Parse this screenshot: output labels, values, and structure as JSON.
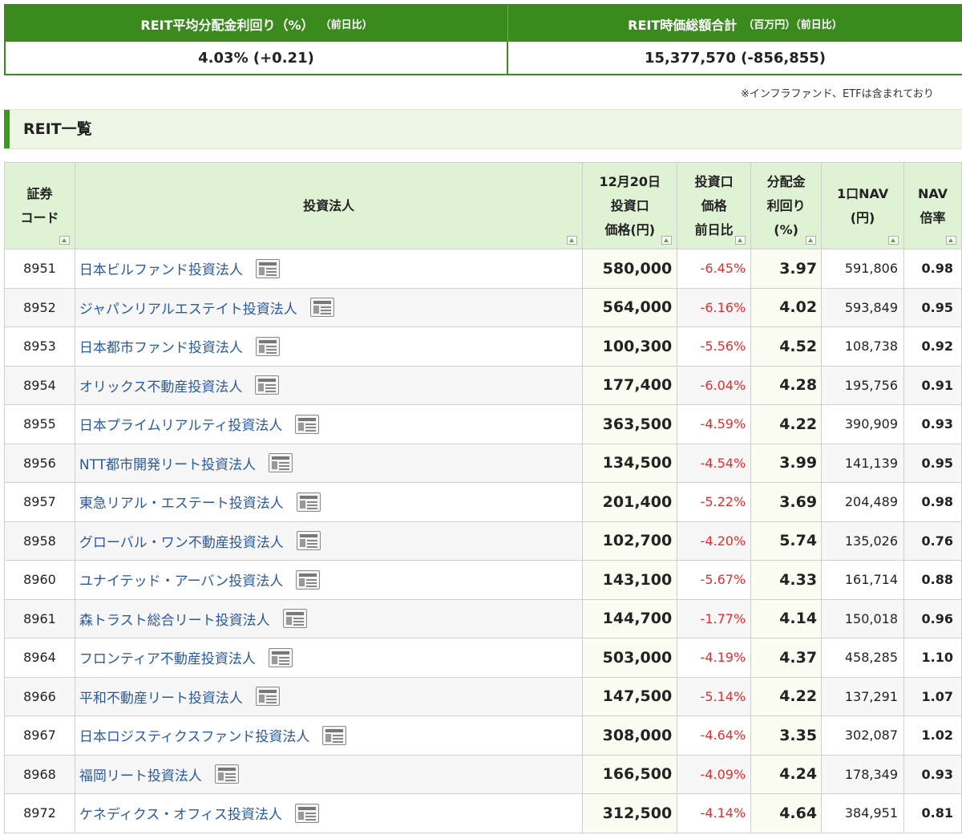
{
  "summary": {
    "yield_header": "REIT平均分配金利回り（%）",
    "yield_header_sub": "（前日比）",
    "yield_value": "4.03% (+0.21)",
    "mcap_header": "REIT時価総額合計",
    "mcap_header_sub": "（百万円）（前日比）",
    "mcap_value": "15,377,570 (-856,855)"
  },
  "note": "※インフラファンド、ETFは含まれており",
  "section_title": "REIT一覧",
  "table": {
    "headers": {
      "code": [
        "証券",
        "コード"
      ],
      "name": "投資法人",
      "price": [
        "12月20日",
        "投資口",
        "価格(円)"
      ],
      "change": [
        "投資口",
        "価格",
        "前日比"
      ],
      "yield": [
        "分配金",
        "利回り",
        "(%)"
      ],
      "nav": [
        "1口NAV",
        "(円)"
      ],
      "ratio": [
        "NAV",
        "倍率"
      ]
    },
    "rows": [
      {
        "code": "8951",
        "name": "日本ビルファンド投資法人",
        "price": "580,000",
        "change": "-6.45%",
        "yield": "3.97",
        "nav": "591,806",
        "ratio": "0.98"
      },
      {
        "code": "8952",
        "name": "ジャパンリアルエステイト投資法人",
        "price": "564,000",
        "change": "-6.16%",
        "yield": "4.02",
        "nav": "593,849",
        "ratio": "0.95"
      },
      {
        "code": "8953",
        "name": "日本都市ファンド投資法人",
        "price": "100,300",
        "change": "-5.56%",
        "yield": "4.52",
        "nav": "108,738",
        "ratio": "0.92"
      },
      {
        "code": "8954",
        "name": "オリックス不動産投資法人",
        "price": "177,400",
        "change": "-6.04%",
        "yield": "4.28",
        "nav": "195,756",
        "ratio": "0.91"
      },
      {
        "code": "8955",
        "name": "日本プライムリアルティ投資法人",
        "price": "363,500",
        "change": "-4.59%",
        "yield": "4.22",
        "nav": "390,909",
        "ratio": "0.93"
      },
      {
        "code": "8956",
        "name": "NTT都市開発リート投資法人",
        "price": "134,500",
        "change": "-4.54%",
        "yield": "3.99",
        "nav": "141,139",
        "ratio": "0.95"
      },
      {
        "code": "8957",
        "name": "東急リアル・エステート投資法人",
        "price": "201,400",
        "change": "-5.22%",
        "yield": "3.69",
        "nav": "204,489",
        "ratio": "0.98"
      },
      {
        "code": "8958",
        "name": "グローバル・ワン不動産投資法人",
        "price": "102,700",
        "change": "-4.20%",
        "yield": "5.74",
        "nav": "135,026",
        "ratio": "0.76"
      },
      {
        "code": "8960",
        "name": "ユナイテッド・アーバン投資法人",
        "price": "143,100",
        "change": "-5.67%",
        "yield": "4.33",
        "nav": "161,714",
        "ratio": "0.88"
      },
      {
        "code": "8961",
        "name": "森トラスト総合リート投資法人",
        "price": "144,700",
        "change": "-1.77%",
        "yield": "4.14",
        "nav": "150,018",
        "ratio": "0.96"
      },
      {
        "code": "8964",
        "name": "フロンティア不動産投資法人",
        "price": "503,000",
        "change": "-4.19%",
        "yield": "4.37",
        "nav": "458,285",
        "ratio": "1.10"
      },
      {
        "code": "8966",
        "name": "平和不動産リート投資法人",
        "price": "147,500",
        "change": "-5.14%",
        "yield": "4.22",
        "nav": "137,291",
        "ratio": "1.07"
      },
      {
        "code": "8967",
        "name": "日本ロジスティクスファンド投資法人",
        "price": "308,000",
        "change": "-4.64%",
        "yield": "3.35",
        "nav": "302,087",
        "ratio": "1.02"
      },
      {
        "code": "8968",
        "name": "福岡リート投資法人",
        "price": "166,500",
        "change": "-4.09%",
        "yield": "4.24",
        "nav": "178,349",
        "ratio": "0.93"
      },
      {
        "code": "8972",
        "name": "ケネディクス・オフィス投資法人",
        "price": "312,500",
        "change": "-4.14%",
        "yield": "4.64",
        "nav": "384,951",
        "ratio": "0.81"
      }
    ]
  }
}
